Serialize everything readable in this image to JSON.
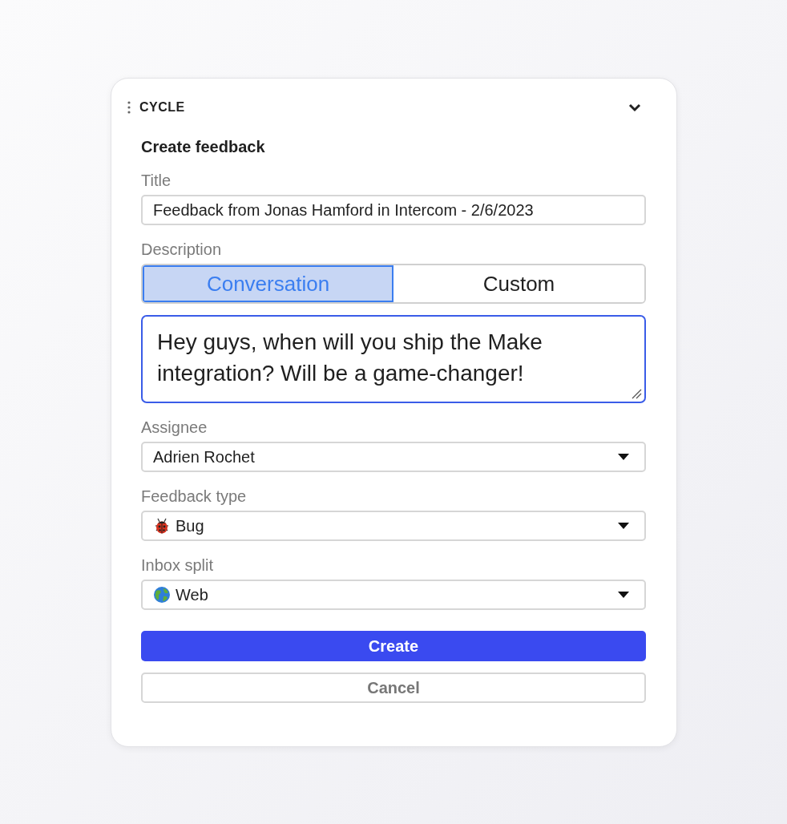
{
  "header": {
    "title": "CYCLE",
    "expanded": true
  },
  "form": {
    "heading": "Create feedback",
    "title_field": {
      "label": "Title",
      "value": "Feedback from Jonas Hamford in Intercom - 2/6/2023"
    },
    "description": {
      "label": "Description",
      "tabs": [
        {
          "label": "Conversation",
          "selected": true
        },
        {
          "label": "Custom",
          "selected": false
        }
      ],
      "value": "Hey guys, when will you ship the Make integration? Will be a game-changer!"
    },
    "selects": [
      {
        "label": "Assignee",
        "value": "Adrien Rochet"
      },
      {
        "label": "Feedback type",
        "value": "Bug"
      },
      {
        "label": "Inbox split",
        "value": "Web"
      }
    ]
  },
  "buttons": [
    {
      "label": "Create",
      "kind": "primary"
    },
    {
      "label": "Cancel",
      "kind": "secondary"
    }
  ]
}
